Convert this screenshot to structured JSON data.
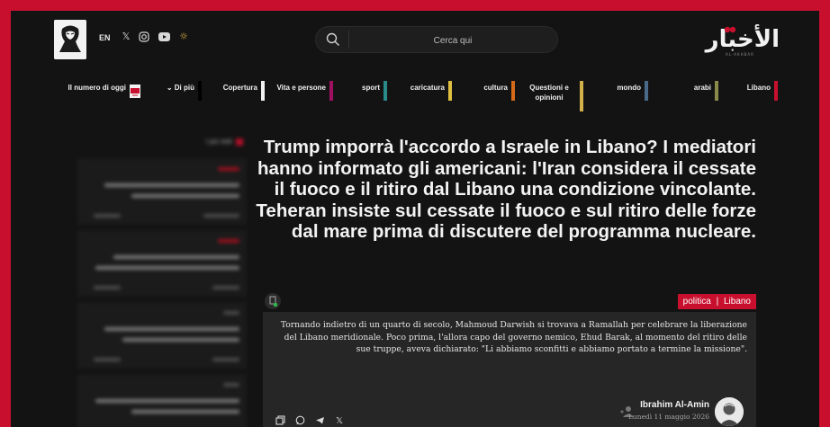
{
  "header": {
    "language": "EN",
    "social_icons": [
      "x-icon",
      "instagram-icon",
      "youtube-icon",
      "sun-icon"
    ],
    "search_placeholder": "Cerca qui",
    "brand_name": "الأخبار",
    "brand_subtitle": "AL-AKHBAR"
  },
  "nav": {
    "items": [
      {
        "label": "Libano",
        "color": "#c8102e"
      },
      {
        "label": "arabi",
        "color": "#8a8a4a"
      },
      {
        "label": "mondo",
        "color": "#4a6a8a"
      },
      {
        "label": "Questioni e opinioni",
        "color": "#d4b04a"
      },
      {
        "label": "cultura",
        "color": "#d46a1a"
      },
      {
        "label": "caricatura",
        "color": "#e0c040"
      },
      {
        "label": "sport",
        "color": "#2a8a8a"
      },
      {
        "label": "Vita e persone",
        "color": "#a01060"
      },
      {
        "label": "Copertura",
        "color": "#f2f2f2"
      },
      {
        "label": "Di più",
        "color": "#111111"
      },
      {
        "label": "Il numero di oggi",
        "color": ""
      }
    ]
  },
  "sidebar": {
    "title": "I più letti"
  },
  "article": {
    "headline": "Trump imporrà l'accordo a Israele in Libano? I mediatori hanno informato gli americani: l'Iran considera il cessate il fuoco e il ritiro dal Libano una condizione vincolante. Teheran insiste sul cessate il fuoco e sul ritiro delle forze dal mare prima di discutere del programma nucleare.",
    "tag_section": "politica",
    "tag_separator": "|",
    "tag_region": "Libano",
    "excerpt": "Tornando indietro di un quarto di secolo, Mahmoud Darwish si trovava a Ramallah per celebrare la liberazione del Libano meridionale. Poco prima, l'allora capo del governo nemico, Ehud Barak, al momento del ritiro delle sue truppe, aveva dichiarato: \"Li abbiamo sconfitti e abbiamo portato a termine la missione\".",
    "author": "Ibrahim Al-Amin",
    "date": "Lunedì 11 maggio 2026",
    "share_icons": [
      "copy-icon",
      "whatsapp-icon",
      "telegram-icon",
      "x-icon"
    ]
  },
  "colors": {
    "accent": "#c8102e",
    "background": "#131313",
    "card": "#262626"
  }
}
